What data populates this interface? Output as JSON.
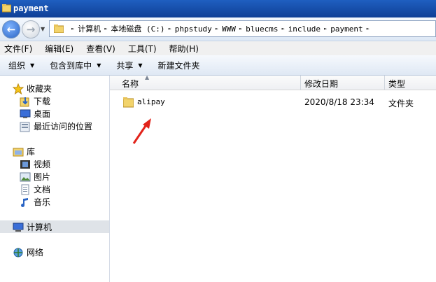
{
  "window": {
    "title": "payment"
  },
  "address": {
    "crumbs": [
      "计算机",
      "本地磁盘 (C:)",
      "phpstudy",
      "WWW",
      "bluecms",
      "include",
      "payment"
    ]
  },
  "menu": [
    "文件(F)",
    "编辑(E)",
    "查看(V)",
    "工具(T)",
    "帮助(H)"
  ],
  "toolbar": {
    "organize": "组织",
    "include_in_library": "包含到库中",
    "share": "共享",
    "new_folder": "新建文件夹"
  },
  "nav": {
    "favorites": {
      "label": "收藏夹",
      "items": [
        "下载",
        "桌面",
        "最近访问的位置"
      ]
    },
    "libraries": {
      "label": "库",
      "items": [
        "视频",
        "图片",
        "文档",
        "音乐"
      ]
    },
    "computer": "计算机",
    "network": "网络"
  },
  "columns": {
    "name": "名称",
    "modified": "修改日期",
    "type": "类型"
  },
  "files": [
    {
      "name": "alipay",
      "modified": "2020/8/18 23:34",
      "type": "文件夹"
    }
  ],
  "colors": {
    "titlebar": "#1f5fc0",
    "annotation_arrow": "#e2231a",
    "folder": "#e8c35a"
  }
}
